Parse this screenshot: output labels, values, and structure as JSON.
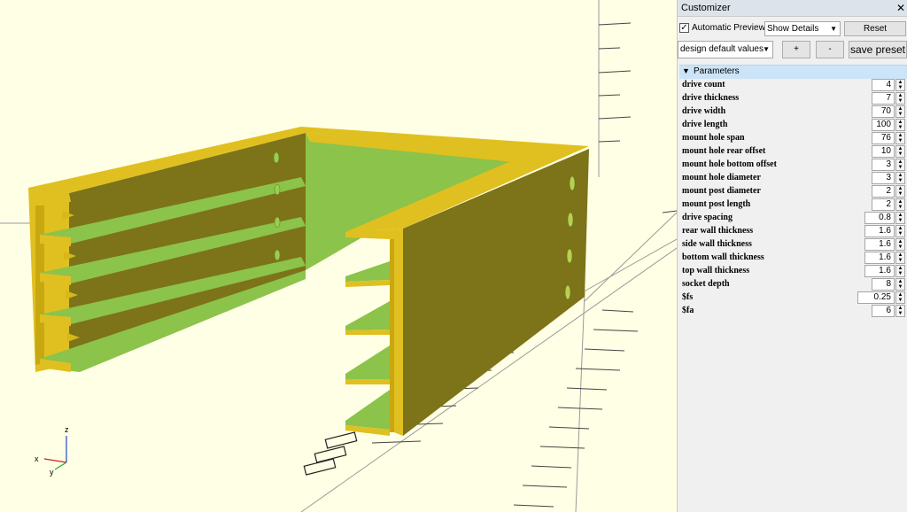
{
  "panel": {
    "title": "Customizer",
    "close": "✕",
    "auto_preview_label": "Automatic Preview",
    "auto_preview_checked": "✓",
    "show_details": "Show Details",
    "reset": "Reset",
    "preset": "design default values",
    "plus": "+",
    "minus": "-",
    "save_preset": "save preset",
    "parameters_header": "Parameters",
    "params": [
      {
        "label": "drive count",
        "value": "4"
      },
      {
        "label": "drive thickness",
        "value": "7"
      },
      {
        "label": "drive width",
        "value": "70"
      },
      {
        "label": "drive length",
        "value": "100"
      },
      {
        "label": "mount hole span",
        "value": "76"
      },
      {
        "label": "mount hole rear offset",
        "value": "10"
      },
      {
        "label": "mount hole bottom offset",
        "value": "3"
      },
      {
        "label": "mount hole diameter",
        "value": "3"
      },
      {
        "label": "mount post diameter",
        "value": "2"
      },
      {
        "label": "mount post length",
        "value": "2"
      },
      {
        "label": "drive spacing",
        "value": "0.8"
      },
      {
        "label": "rear wall thickness",
        "value": "1.6"
      },
      {
        "label": "side wall thickness",
        "value": "1.6"
      },
      {
        "label": "bottom wall thickness",
        "value": "1.6"
      },
      {
        "label": "top wall thickness",
        "value": "1.6"
      },
      {
        "label": "socket depth",
        "value": "8"
      },
      {
        "label": "$fs",
        "value": "0.25"
      },
      {
        "label": "$fa",
        "value": "6"
      }
    ]
  },
  "viewport": {
    "axis_x": "x",
    "axis_y": "y",
    "axis_z": "z"
  }
}
